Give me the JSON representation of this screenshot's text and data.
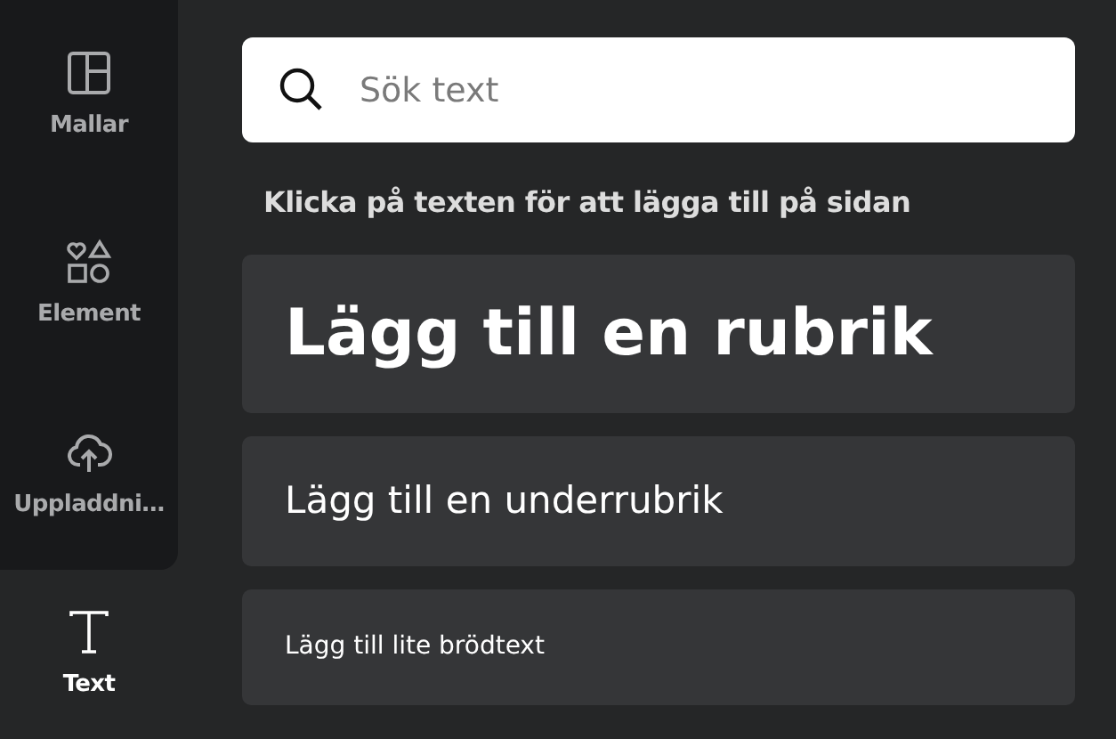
{
  "sidebar": {
    "items": [
      {
        "label": "Mallar",
        "selected": false
      },
      {
        "label": "Element",
        "selected": false
      },
      {
        "label": "Uppladdni…",
        "selected": false
      },
      {
        "label": "Text",
        "selected": true
      }
    ]
  },
  "search": {
    "placeholder": "Sök text"
  },
  "hint": "Klicka på texten för att lägga till på sidan",
  "text_cards": [
    {
      "kind": "heading",
      "label": "Lägg till en rubrik"
    },
    {
      "kind": "subheading",
      "label": "Lägg till en underrubrik"
    },
    {
      "kind": "body",
      "label": "Lägg till lite brödtext"
    }
  ]
}
